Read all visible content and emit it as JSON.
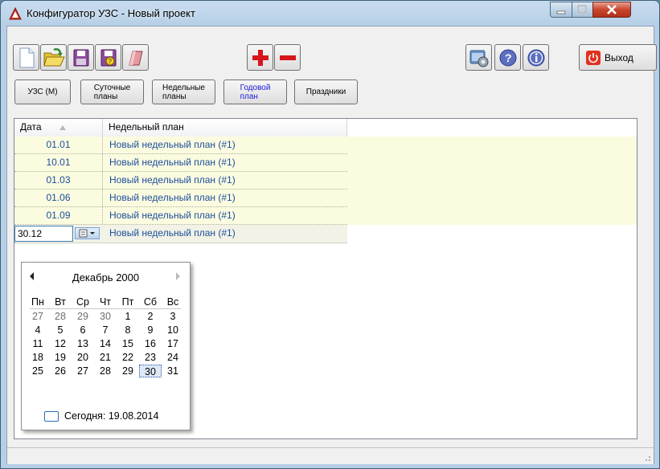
{
  "window": {
    "title": "Конфигуратор УЗС - Новый проект"
  },
  "toolbar": {
    "icons": [
      "new-file-icon",
      "open-folder-icon",
      "save-icon",
      "save-as-icon",
      "eraser-icon",
      "add-icon",
      "remove-icon",
      "settings-icon",
      "help-icon",
      "info-icon",
      "power-icon"
    ],
    "exit_label": "Выход"
  },
  "tabs": [
    {
      "label": "УЗС (М)",
      "selected": false
    },
    {
      "label": "Суточные\nпланы",
      "selected": false
    },
    {
      "label": "Недельные\nпланы",
      "selected": false
    },
    {
      "label": "Годовой\nплан",
      "selected": true
    },
    {
      "label": "Праздники",
      "selected": false
    }
  ],
  "grid": {
    "columns": [
      "Дата",
      "Недельный план"
    ],
    "rows": [
      {
        "date": "01.01",
        "plan": "Новый недельный план (#1)"
      },
      {
        "date": "10.01",
        "plan": "Новый недельный план (#1)"
      },
      {
        "date": "01.03",
        "plan": "Новый недельный план (#1)"
      },
      {
        "date": "01.06",
        "plan": "Новый недельный план (#1)"
      },
      {
        "date": "01.09",
        "plan": "Новый недельный план (#1)"
      }
    ],
    "edit_row": {
      "date": "30.12",
      "plan": "Новый недельный план (#1)"
    }
  },
  "calendar": {
    "month_label": "Декабрь 2000",
    "weekdays": [
      "Пн",
      "Вт",
      "Ср",
      "Чт",
      "Пт",
      "Сб",
      "Вс"
    ],
    "weeks": [
      [
        [
          "27",
          1
        ],
        [
          "28",
          1
        ],
        [
          "29",
          1
        ],
        [
          "30",
          1
        ],
        [
          "1",
          0
        ],
        [
          "2",
          0
        ],
        [
          "3",
          0
        ]
      ],
      [
        [
          "4",
          0
        ],
        [
          "5",
          0
        ],
        [
          "6",
          0
        ],
        [
          "7",
          0
        ],
        [
          "8",
          0
        ],
        [
          "9",
          0
        ],
        [
          "10",
          0
        ]
      ],
      [
        [
          "11",
          0
        ],
        [
          "12",
          0
        ],
        [
          "13",
          0
        ],
        [
          "14",
          0
        ],
        [
          "15",
          0
        ],
        [
          "16",
          0
        ],
        [
          "17",
          0
        ]
      ],
      [
        [
          "18",
          0
        ],
        [
          "19",
          0
        ],
        [
          "20",
          0
        ],
        [
          "21",
          0
        ],
        [
          "22",
          0
        ],
        [
          "23",
          0
        ],
        [
          "24",
          0
        ]
      ],
      [
        [
          "25",
          0
        ],
        [
          "26",
          0
        ],
        [
          "27",
          0
        ],
        [
          "28",
          0
        ],
        [
          "29",
          0
        ],
        [
          "30",
          2
        ],
        [
          "31",
          0
        ]
      ]
    ],
    "today_label": "Сегодня: 19.08.2014"
  },
  "colors": {
    "accent": "#1c4e9c",
    "row_bg": "#fbfbe0",
    "danger": "#d8141c"
  }
}
